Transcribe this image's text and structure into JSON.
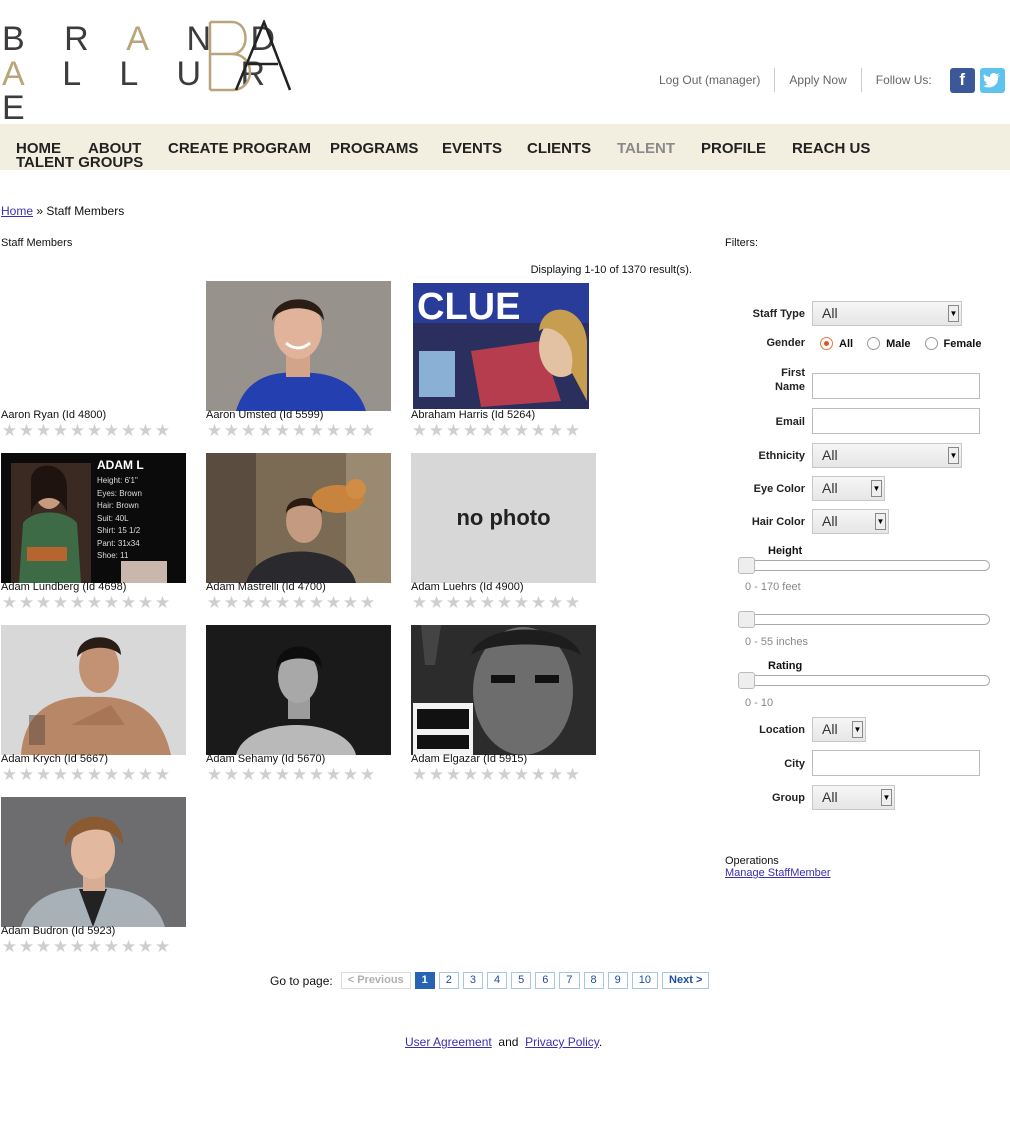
{
  "brand": {
    "line1": "BRAND",
    "line2": "ALLURE",
    "monogram": "BA"
  },
  "top_links": {
    "logout": "Log Out (manager)",
    "apply": "Apply Now",
    "follow": "Follow Us:",
    "facebook_icon": "f",
    "twitter_icon": "t"
  },
  "nav": {
    "items": [
      "HOME",
      "ABOUT",
      "CREATE PROGRAM",
      "PROGRAMS",
      "EVENTS",
      "CLIENTS",
      "TALENT",
      "PROFILE",
      "REACH US",
      "TALENT GROUPS"
    ],
    "active": "TALENT"
  },
  "breadcrumb": {
    "home": "Home",
    "separator": "»",
    "current": "Staff Members"
  },
  "page_title": "Staff Members",
  "result_count": "Displaying 1-10 of 1370 result(s).",
  "staff": [
    {
      "name": "Aaron Ryan (Id 4800)",
      "photo": "none"
    },
    {
      "name": "Aaron Umsted (Id 5599)",
      "photo": "portrait-blue"
    },
    {
      "name": "Abraham Harris (Id 5264)",
      "photo": "clue-box"
    },
    {
      "name": "Adam Lundberg (Id 4698)",
      "photo": "comp-card"
    },
    {
      "name": "Adam Mastrelli (Id 4700)",
      "photo": "portrait-cat"
    },
    {
      "name": "Adam Luehrs (Id 4900)",
      "photo": "no-photo"
    },
    {
      "name": "Adam Krych (Id 5667)",
      "photo": "portrait-shirtless"
    },
    {
      "name": "Adam Sehamy (Id 5670)",
      "photo": "portrait-bw"
    },
    {
      "name": "Adam Elgazar (Id 5915)",
      "photo": "portrait-dark"
    },
    {
      "name": "Adam Budron (Id 5923)",
      "photo": "portrait-suit"
    }
  ],
  "rating_star_count": 10,
  "no_photo_text": "no photo",
  "comp_card": {
    "title": "ADAM L",
    "lines": [
      "Height: 6'1\"",
      "Eyes: Brown",
      "Hair: Brown",
      "Suit: 40L",
      "Shirt: 15 1/2",
      "Pant: 31x34",
      "Shoe: 11"
    ]
  },
  "clue_text": "CLUE",
  "pager": {
    "label": "Go to page:",
    "previous": "< Previous",
    "pages": [
      "1",
      "2",
      "3",
      "4",
      "5",
      "6",
      "7",
      "8",
      "9",
      "10"
    ],
    "current": "1",
    "next": "Next >"
  },
  "footer": {
    "user_agreement": "User Agreement",
    "and": "and",
    "privacy": "Privacy Policy",
    "period": "."
  },
  "filters": {
    "title": "Filters:",
    "staff_type_label": "Staff Type",
    "staff_type_value": "All",
    "gender_label": "Gender",
    "gender_options": [
      "All",
      "Male",
      "Female"
    ],
    "gender_selected": "All",
    "first_name_label_1": "First",
    "first_name_label_2": "Name",
    "first_name_value": "",
    "email_label": "Email",
    "email_value": "",
    "ethnicity_label": "Ethnicity",
    "ethnicity_value": "All",
    "eye_color_label": "Eye Color",
    "eye_color_value": "All",
    "hair_color_label": "Hair Color",
    "hair_color_value": "All",
    "height_label": "Height",
    "height_feet_range": "0 - 170 feet",
    "height_inches_range": "0 - 55 inches",
    "rating_label": "Rating",
    "rating_range": "0 - 10",
    "location_label": "Location",
    "location_value": "All",
    "city_label": "City",
    "city_value": "",
    "group_label": "Group",
    "group_value": "All"
  },
  "operations": {
    "title": "Operations",
    "manage_link": "Manage StaffMember"
  },
  "colors": {
    "nav_bg": "#f3efe0",
    "brand_gold": "#b9a57a",
    "link": "#3a2fb0",
    "pager_current": "#2863b3"
  }
}
